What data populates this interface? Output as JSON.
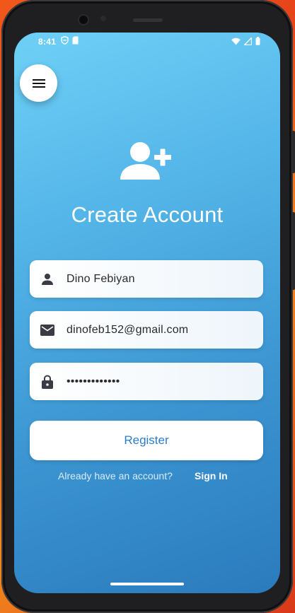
{
  "status": {
    "time": "8:41"
  },
  "header": {
    "title": "Create Account"
  },
  "form": {
    "name_value": "Dino Febiyan",
    "email_value": "dinofeb152@gmail.com",
    "password_value": "•••••••••••••"
  },
  "actions": {
    "register_label": "Register",
    "already_text": "Already have an account?",
    "signin_label": "Sign In"
  },
  "colors": {
    "accent": "#2c7dc9",
    "gradient_top": "#6fd0f6",
    "gradient_bottom": "#2a7bbd"
  },
  "icons": [
    "menu-icon",
    "person-add-icon",
    "person-icon",
    "mail-icon",
    "lock-icon"
  ]
}
